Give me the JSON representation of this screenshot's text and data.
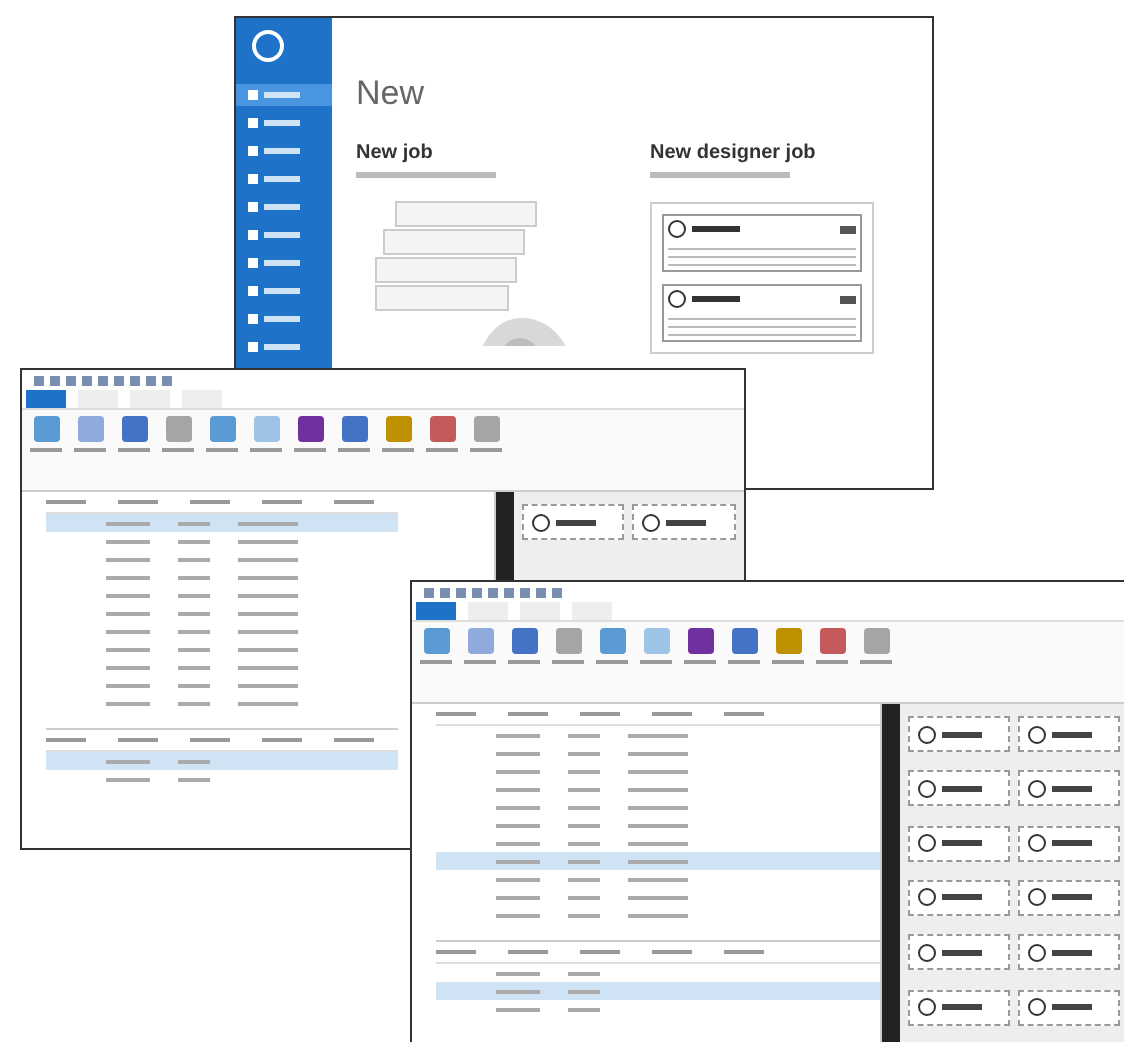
{
  "backstage": {
    "heading": "New",
    "sidebar_items": [
      {
        "selected": true
      },
      {
        "selected": false
      },
      {
        "selected": false
      },
      {
        "selected": false
      },
      {
        "selected": false
      },
      {
        "selected": false
      },
      {
        "selected": false
      },
      {
        "selected": false
      },
      {
        "selected": false
      },
      {
        "selected": false
      }
    ],
    "cards": [
      {
        "title": "New job",
        "kind": "roll"
      },
      {
        "title": "New designer job",
        "kind": "labels"
      }
    ]
  },
  "editors": [
    {
      "tabs": [
        {
          "selected": true
        },
        {
          "selected": false
        },
        {
          "selected": false
        },
        {
          "selected": false
        }
      ],
      "rows": [
        {
          "selected": true
        },
        {
          "selected": false
        },
        {
          "selected": false
        },
        {
          "selected": false
        },
        {
          "selected": false
        },
        {
          "selected": false
        },
        {
          "selected": false
        },
        {
          "selected": false
        },
        {
          "selected": false
        },
        {
          "selected": false
        },
        {
          "selected": false
        }
      ],
      "detail_rows": [
        {
          "selected": true
        },
        {
          "selected": false
        }
      ]
    },
    {
      "tabs": [
        {
          "selected": true
        },
        {
          "selected": false
        },
        {
          "selected": false
        },
        {
          "selected": false
        }
      ],
      "rows": [
        {
          "selected": false
        },
        {
          "selected": false
        },
        {
          "selected": false
        },
        {
          "selected": false
        },
        {
          "selected": false
        },
        {
          "selected": false
        },
        {
          "selected": false
        },
        {
          "selected": true
        },
        {
          "selected": false
        },
        {
          "selected": false
        },
        {
          "selected": false
        }
      ],
      "detail_rows": [
        {
          "selected": false
        },
        {
          "selected": true
        },
        {
          "selected": false
        }
      ]
    }
  ]
}
